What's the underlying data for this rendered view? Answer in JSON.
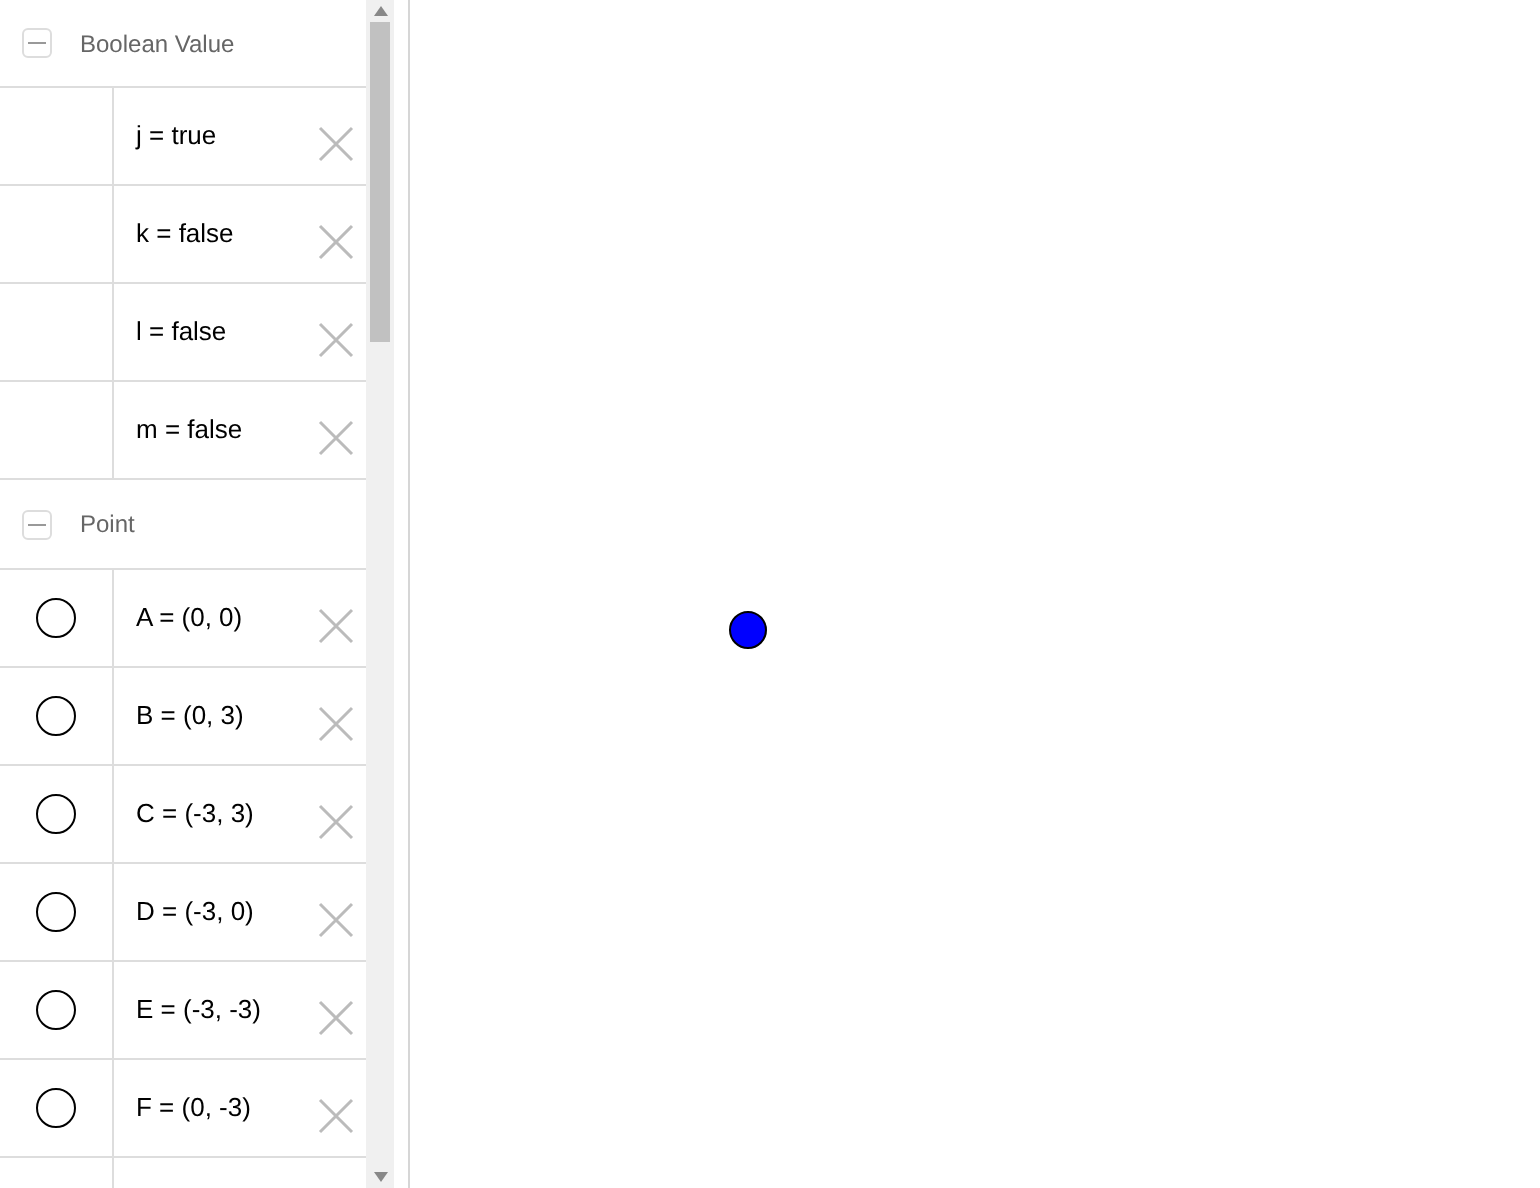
{
  "algebra_view": {
    "groups": [
      {
        "title": "Boolean Value",
        "expanded": true,
        "kind": "boolean",
        "items": [
          {
            "text": "j = true"
          },
          {
            "text": "k = false"
          },
          {
            "text": "l = false"
          },
          {
            "text": "m = false"
          }
        ]
      },
      {
        "title": "Point",
        "expanded": true,
        "kind": "point",
        "items": [
          {
            "text": "A = (0, 0)",
            "shown": false
          },
          {
            "text": "B = (0, 3)",
            "shown": false
          },
          {
            "text": "C = (-3, 3)",
            "shown": false
          },
          {
            "text": "D = (-3, 0)",
            "shown": false
          },
          {
            "text": "E = (-3, -3)",
            "shown": false
          },
          {
            "text": "F = (0, -3)",
            "shown": false
          }
        ]
      }
    ]
  }
}
